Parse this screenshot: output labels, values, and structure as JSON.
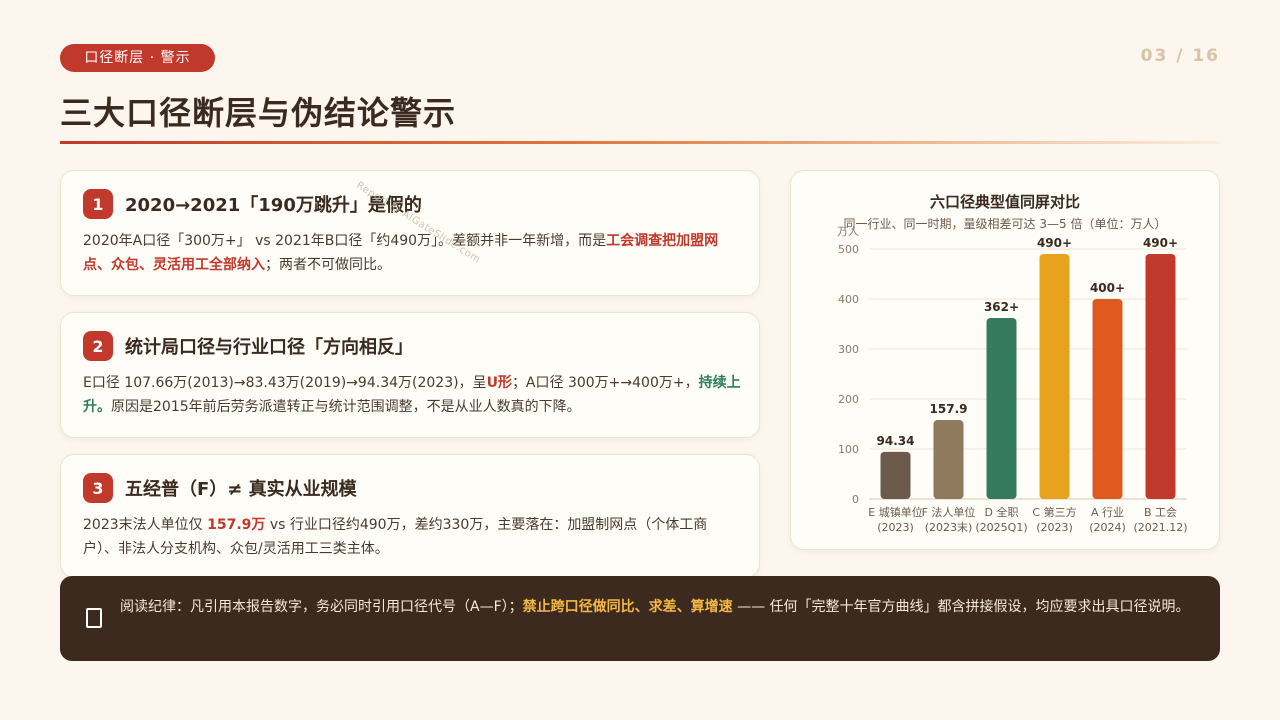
{
  "header": {
    "tag": "口径断层 · 警示",
    "page": "03 / 16",
    "title": "三大口径断层与伪结论警示"
  },
  "watermark": "Report @ AIGateSlide.com",
  "cards": [
    {
      "num": "1",
      "title": "2020→2021「190万跳升」是假的",
      "body_1": "2020年A口径「300万+」 vs 2021年B口径「约490万」。差额并非一年新增，而是",
      "body_hl": "工会调查把加盟网点、众包、灵活用工全部纳入",
      "body_2": "；两者不可做同比。"
    },
    {
      "num": "2",
      "title": "统计局口径与行业口径「方向相反」",
      "body_1": "E口径 107.66万(2013)→83.43万(2019)→94.34万(2023)，呈",
      "body_hl": "U形",
      "body_2": "；A口径 300万+→400万+，",
      "body_hl2": "持续上升。",
      "body_3": "原因是2015年前后劳务派遣转正与统计范围调整，不是从业人数真的下降。"
    },
    {
      "num": "3",
      "title": "五经普（F）≠ 真实从业规模",
      "body_1": "2023末法人单位仅 ",
      "body_hl": "157.9万",
      "body_2": " vs 行业口径约490万，差约330万，主要落在：加盟制网点（个体工商户）、非法人分支机构、众包/灵活用工三类主体。"
    }
  ],
  "chart_data": {
    "type": "bar",
    "title": "六口径典型值同屏对比",
    "subtitle": "同一行业、同一时期，量级相差可达 3—5 倍（单位：万人）",
    "ylabel": "万人",
    "ylim": [
      0,
      500
    ],
    "yticks": [
      "0",
      "100",
      "200",
      "300",
      "400",
      "500"
    ],
    "grid": true,
    "categories": [
      {
        "line1": "E 城镇单位",
        "line2": "(2023)"
      },
      {
        "line1": "F 法人单位",
        "line2": "(2023末)"
      },
      {
        "line1": "D 全职",
        "line2": "(2025Q1)"
      },
      {
        "line1": "C 第三方",
        "line2": "(2023)"
      },
      {
        "line1": "A 行业",
        "line2": "(2024)"
      },
      {
        "line1": "B 工会",
        "line2": "(2021.12)"
      }
    ],
    "values": [
      94.34,
      157.9,
      362,
      490,
      400,
      490
    ],
    "labels": [
      "94.34",
      "157.9",
      "362+",
      "490+",
      "400+",
      "490+"
    ],
    "colors": [
      "#6b5a4c",
      "#8f7a5e",
      "#367a5e",
      "#e8a21e",
      "#df5a1f",
      "#c0392b"
    ]
  },
  "footer": {
    "icon": "book-icon",
    "text_1": "阅读纪律：凡引用本报告数字，务必同时引用口径代号（A—F）；",
    "text_hl": "禁止跨口径做同比、求差、算增速",
    "text_2": " —— 任何「完整十年官方曲线」都含拼接假设，均应要求出具口径说明。"
  }
}
